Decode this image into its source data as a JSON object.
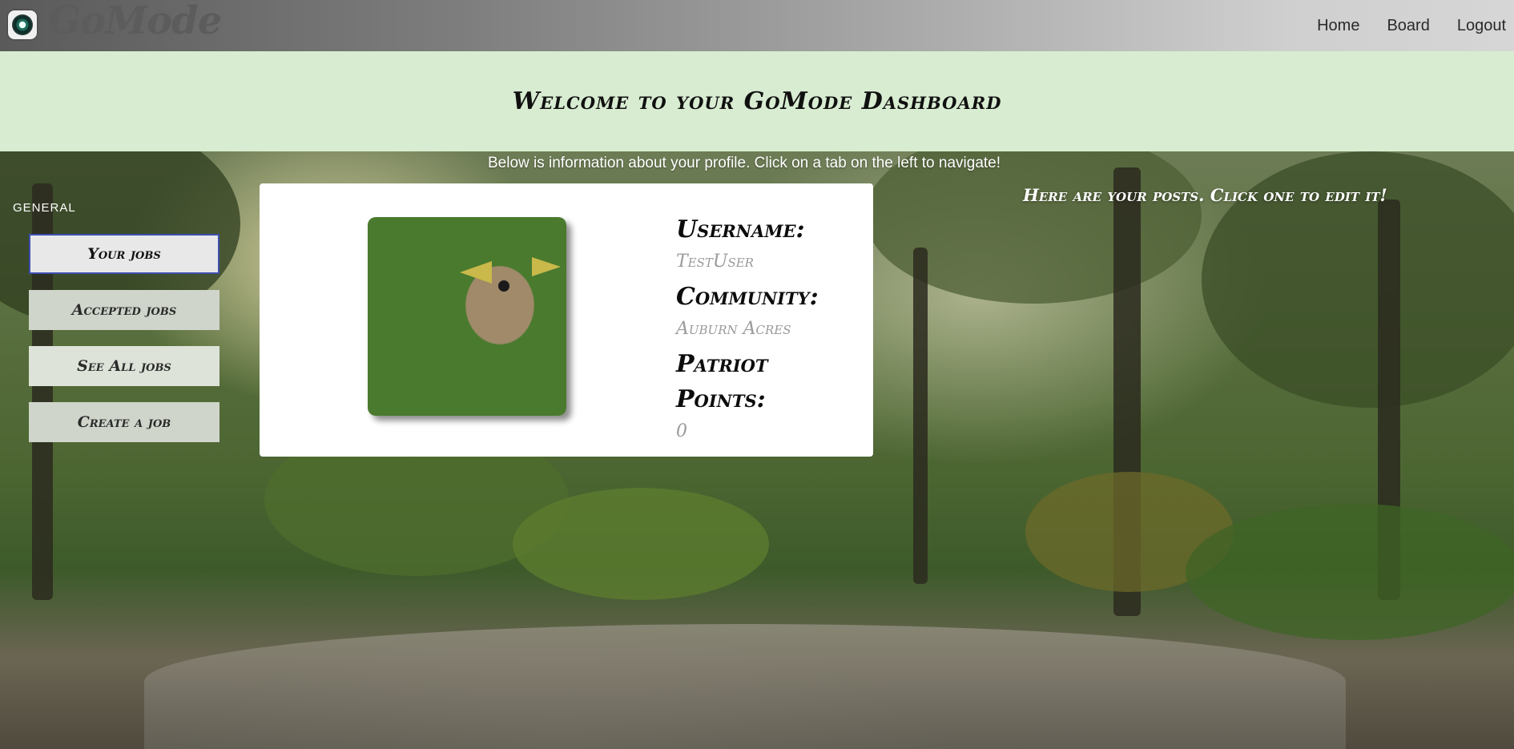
{
  "app": {
    "brand": "GoMode",
    "logo_icon": "gomode-logo-icon"
  },
  "nav": {
    "items": [
      {
        "label": "Home"
      },
      {
        "label": "Board"
      },
      {
        "label": "Logout"
      }
    ]
  },
  "header": {
    "title": "Welcome to your GoMode Dashboard"
  },
  "subtitle": "Below is information about your profile. Click on a tab on the left to navigate!",
  "sidebar": {
    "section": "GENERAL",
    "items": [
      {
        "label": "Your jobs",
        "active": true
      },
      {
        "label": "Accepted jobs",
        "active": false
      },
      {
        "label": "See All jobs",
        "active": false
      },
      {
        "label": "Create a job",
        "active": false
      }
    ]
  },
  "profile": {
    "avatar_icon": "monster-avatar",
    "username_label": "Username:",
    "username": "TestUser",
    "community_label": "Community:",
    "community": "Auburn Acres",
    "points_label_line1": "Patriot",
    "points_label_line2": "Points:",
    "points": "0"
  },
  "posts": {
    "note": "Here are your posts. Click one to edit it!"
  },
  "colors": {
    "header_band": "#d8ecd1",
    "active_tab_border": "#3d4fb0",
    "card": "#ffffff"
  }
}
